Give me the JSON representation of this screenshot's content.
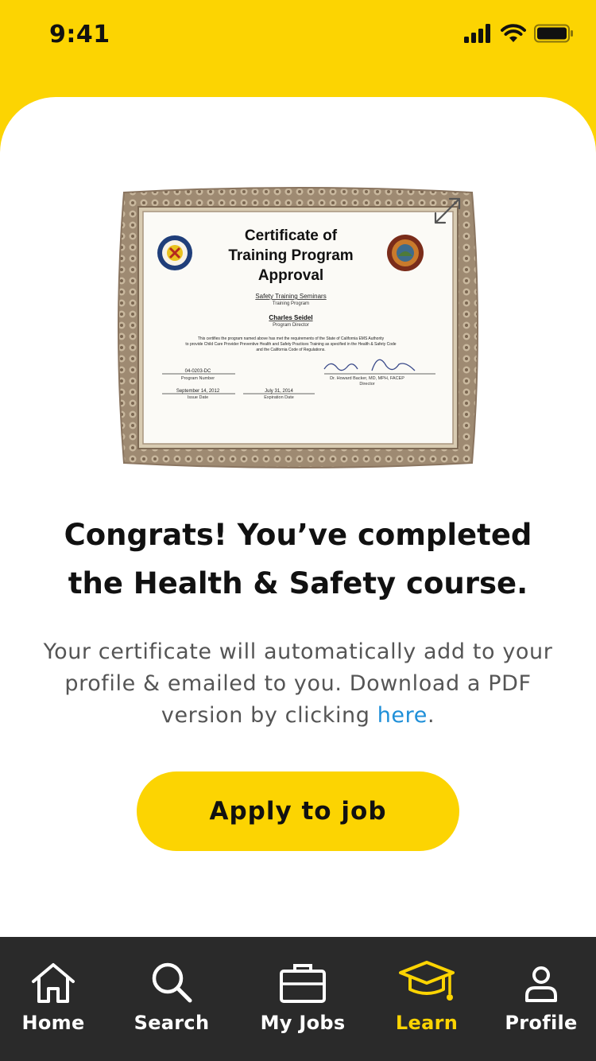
{
  "status_bar": {
    "time": "9:41"
  },
  "certificate": {
    "title_line1": "Certificate of",
    "title_line2": "Training Program",
    "title_line3": "Approval",
    "program": "Safety Training Seminars",
    "program_caption": "Training Program",
    "director": "Charles Seidel",
    "director_caption": "Program Director",
    "body_line1": "This certifies the program named above has met the requirements of the State of California EMS Authority",
    "body_line2": "to provide Child Care Provider Preventive Health and Safety Practices Training as specified in the Health & Safety Code",
    "body_line3": "and the California Code of Regulations.",
    "program_number": "04-0203-DC",
    "program_number_caption": "Program Number",
    "issue_date": "September 14, 2012",
    "issue_date_caption": "Issue Date",
    "expiration_date": "July 31, 2014",
    "expiration_date_caption": "Expiration Date",
    "signer": "Dr. Howard Backer, MD, MPH, FACEP",
    "signer_caption": "Director",
    "seal_left_text": "EMSA"
  },
  "headline": {
    "line1": "Congrats! You’ve completed",
    "line2": "the Health & Safety course."
  },
  "description": {
    "text_before": "Your certificate will automatically add to your profile & emailed to you. Download a PDF version by clicking ",
    "link": "here",
    "text_after": "."
  },
  "apply_button": {
    "label": "Apply to job"
  },
  "tabs": [
    {
      "label": "Home",
      "icon": "home-icon"
    },
    {
      "label": "Search",
      "icon": "search-icon"
    },
    {
      "label": "My Jobs",
      "icon": "briefcase-icon"
    },
    {
      "label": "Learn",
      "icon": "graduation-cap-icon",
      "active": true
    },
    {
      "label": "Profile",
      "icon": "person-icon"
    }
  ],
  "colors": {
    "accent": "#FCD402",
    "tabbar": "#2A2A2A",
    "link": "#1E8FD8"
  }
}
